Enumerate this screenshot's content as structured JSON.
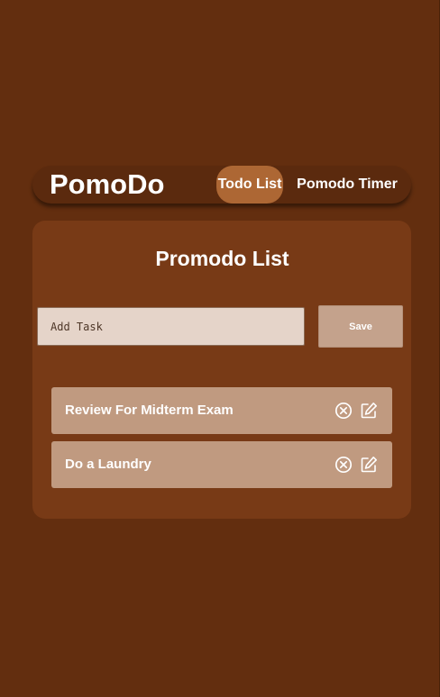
{
  "app": {
    "brand": "PomoDo"
  },
  "nav": {
    "tabs": [
      {
        "label": "Todo List",
        "active": true
      },
      {
        "label": "Pomodo Timer",
        "active": false
      }
    ]
  },
  "list": {
    "title": "Promodo List",
    "input": {
      "placeholder": "Add Task",
      "value": ""
    },
    "save_label": "Save",
    "tasks": [
      {
        "text": "Review For Midterm Exam",
        "delete_icon": "circle-x-icon",
        "edit_icon": "edit-icon"
      },
      {
        "text": "Do a Laundry",
        "delete_icon": "circle-x-icon",
        "edit_icon": "edit-icon"
      }
    ]
  },
  "colors": {
    "background": "#632e0f",
    "navbar": "#5b2a0e",
    "active_tab": "#ad6734",
    "card": "#783a16",
    "input": "#e5d4c9",
    "save_button": "#c4a28c",
    "task_item": "#c09a80",
    "text": "#ffffff"
  }
}
